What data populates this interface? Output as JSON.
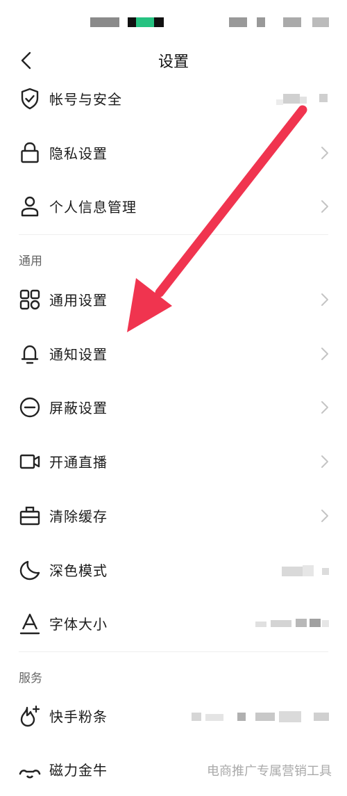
{
  "header": {
    "title": "设置"
  },
  "account_items": [
    {
      "label": "帐号与安全",
      "icon": "shield-check-icon"
    },
    {
      "label": "隐私设置",
      "icon": "lock-icon"
    },
    {
      "label": "个人信息管理",
      "icon": "person-icon"
    }
  ],
  "general": {
    "section_title": "通用",
    "items": [
      {
        "label": "通用设置",
        "icon": "grid-icon"
      },
      {
        "label": "通知设置",
        "icon": "bell-icon"
      },
      {
        "label": "屏蔽设置",
        "icon": "block-icon"
      },
      {
        "label": "开通直播",
        "icon": "video-camera-icon"
      },
      {
        "label": "清除缓存",
        "icon": "briefcase-icon"
      },
      {
        "label": "深色模式",
        "icon": "moon-icon"
      },
      {
        "label": "字体大小",
        "icon": "font-size-icon"
      }
    ]
  },
  "services": {
    "section_title": "服务",
    "items": [
      {
        "label": "快手粉条",
        "icon": "flame-plus-icon"
      },
      {
        "label": "磁力金牛",
        "icon": "cattle-icon",
        "value": "电商推广专属营销工具"
      }
    ]
  },
  "colors": {
    "arrow": "#f0344f",
    "accent_green": "#26c281"
  }
}
